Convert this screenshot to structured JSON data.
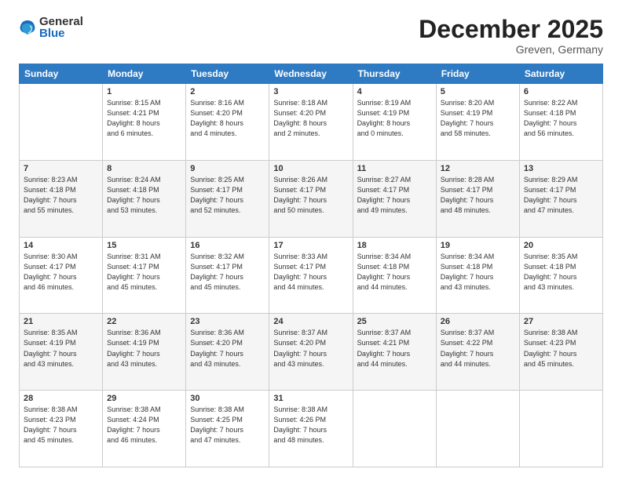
{
  "logo": {
    "general": "General",
    "blue": "Blue"
  },
  "title": "December 2025",
  "location": "Greven, Germany",
  "days_header": [
    "Sunday",
    "Monday",
    "Tuesday",
    "Wednesday",
    "Thursday",
    "Friday",
    "Saturday"
  ],
  "weeks": [
    [
      {
        "day": "",
        "detail": ""
      },
      {
        "day": "1",
        "detail": "Sunrise: 8:15 AM\nSunset: 4:21 PM\nDaylight: 8 hours\nand 6 minutes."
      },
      {
        "day": "2",
        "detail": "Sunrise: 8:16 AM\nSunset: 4:20 PM\nDaylight: 8 hours\nand 4 minutes."
      },
      {
        "day": "3",
        "detail": "Sunrise: 8:18 AM\nSunset: 4:20 PM\nDaylight: 8 hours\nand 2 minutes."
      },
      {
        "day": "4",
        "detail": "Sunrise: 8:19 AM\nSunset: 4:19 PM\nDaylight: 8 hours\nand 0 minutes."
      },
      {
        "day": "5",
        "detail": "Sunrise: 8:20 AM\nSunset: 4:19 PM\nDaylight: 7 hours\nand 58 minutes."
      },
      {
        "day": "6",
        "detail": "Sunrise: 8:22 AM\nSunset: 4:18 PM\nDaylight: 7 hours\nand 56 minutes."
      }
    ],
    [
      {
        "day": "7",
        "detail": "Sunrise: 8:23 AM\nSunset: 4:18 PM\nDaylight: 7 hours\nand 55 minutes."
      },
      {
        "day": "8",
        "detail": "Sunrise: 8:24 AM\nSunset: 4:18 PM\nDaylight: 7 hours\nand 53 minutes."
      },
      {
        "day": "9",
        "detail": "Sunrise: 8:25 AM\nSunset: 4:17 PM\nDaylight: 7 hours\nand 52 minutes."
      },
      {
        "day": "10",
        "detail": "Sunrise: 8:26 AM\nSunset: 4:17 PM\nDaylight: 7 hours\nand 50 minutes."
      },
      {
        "day": "11",
        "detail": "Sunrise: 8:27 AM\nSunset: 4:17 PM\nDaylight: 7 hours\nand 49 minutes."
      },
      {
        "day": "12",
        "detail": "Sunrise: 8:28 AM\nSunset: 4:17 PM\nDaylight: 7 hours\nand 48 minutes."
      },
      {
        "day": "13",
        "detail": "Sunrise: 8:29 AM\nSunset: 4:17 PM\nDaylight: 7 hours\nand 47 minutes."
      }
    ],
    [
      {
        "day": "14",
        "detail": "Sunrise: 8:30 AM\nSunset: 4:17 PM\nDaylight: 7 hours\nand 46 minutes."
      },
      {
        "day": "15",
        "detail": "Sunrise: 8:31 AM\nSunset: 4:17 PM\nDaylight: 7 hours\nand 45 minutes."
      },
      {
        "day": "16",
        "detail": "Sunrise: 8:32 AM\nSunset: 4:17 PM\nDaylight: 7 hours\nand 45 minutes."
      },
      {
        "day": "17",
        "detail": "Sunrise: 8:33 AM\nSunset: 4:17 PM\nDaylight: 7 hours\nand 44 minutes."
      },
      {
        "day": "18",
        "detail": "Sunrise: 8:34 AM\nSunset: 4:18 PM\nDaylight: 7 hours\nand 44 minutes."
      },
      {
        "day": "19",
        "detail": "Sunrise: 8:34 AM\nSunset: 4:18 PM\nDaylight: 7 hours\nand 43 minutes."
      },
      {
        "day": "20",
        "detail": "Sunrise: 8:35 AM\nSunset: 4:18 PM\nDaylight: 7 hours\nand 43 minutes."
      }
    ],
    [
      {
        "day": "21",
        "detail": "Sunrise: 8:35 AM\nSunset: 4:19 PM\nDaylight: 7 hours\nand 43 minutes."
      },
      {
        "day": "22",
        "detail": "Sunrise: 8:36 AM\nSunset: 4:19 PM\nDaylight: 7 hours\nand 43 minutes."
      },
      {
        "day": "23",
        "detail": "Sunrise: 8:36 AM\nSunset: 4:20 PM\nDaylight: 7 hours\nand 43 minutes."
      },
      {
        "day": "24",
        "detail": "Sunrise: 8:37 AM\nSunset: 4:20 PM\nDaylight: 7 hours\nand 43 minutes."
      },
      {
        "day": "25",
        "detail": "Sunrise: 8:37 AM\nSunset: 4:21 PM\nDaylight: 7 hours\nand 44 minutes."
      },
      {
        "day": "26",
        "detail": "Sunrise: 8:37 AM\nSunset: 4:22 PM\nDaylight: 7 hours\nand 44 minutes."
      },
      {
        "day": "27",
        "detail": "Sunrise: 8:38 AM\nSunset: 4:23 PM\nDaylight: 7 hours\nand 45 minutes."
      }
    ],
    [
      {
        "day": "28",
        "detail": "Sunrise: 8:38 AM\nSunset: 4:23 PM\nDaylight: 7 hours\nand 45 minutes."
      },
      {
        "day": "29",
        "detail": "Sunrise: 8:38 AM\nSunset: 4:24 PM\nDaylight: 7 hours\nand 46 minutes."
      },
      {
        "day": "30",
        "detail": "Sunrise: 8:38 AM\nSunset: 4:25 PM\nDaylight: 7 hours\nand 47 minutes."
      },
      {
        "day": "31",
        "detail": "Sunrise: 8:38 AM\nSunset: 4:26 PM\nDaylight: 7 hours\nand 48 minutes."
      },
      {
        "day": "",
        "detail": ""
      },
      {
        "day": "",
        "detail": ""
      },
      {
        "day": "",
        "detail": ""
      }
    ]
  ]
}
